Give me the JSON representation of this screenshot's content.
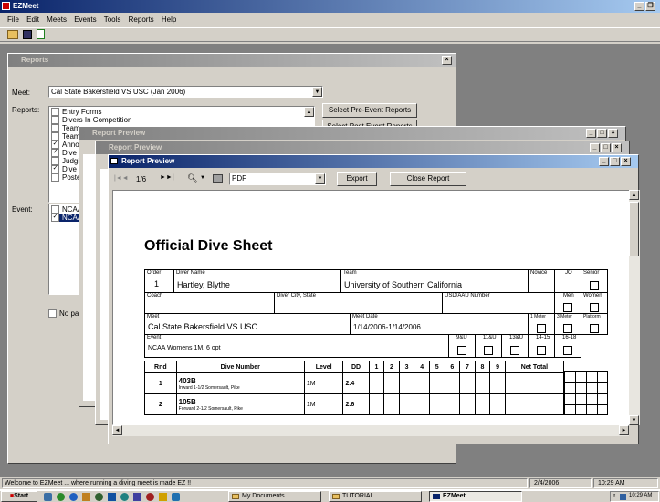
{
  "app": {
    "title": "EZMeet",
    "menu": [
      "File",
      "Edit",
      "Meets",
      "Events",
      "Tools",
      "Reports",
      "Help"
    ]
  },
  "reports_window": {
    "title": "Reports",
    "meet_label": "Meet:",
    "meet_value": "Cal State Bakersfield VS USC (Jan 2006)",
    "reports_label": "Reports:",
    "report_items": [
      {
        "label": "Entry Forms",
        "checked": false
      },
      {
        "label": "Divers In Competition",
        "checked": false
      },
      {
        "label": "Teams",
        "checked": false
      },
      {
        "label": "Teams",
        "checked": false
      },
      {
        "label": "Annou",
        "checked": true
      },
      {
        "label": "Dive O",
        "checked": true
      },
      {
        "label": "Judgin",
        "checked": false
      },
      {
        "label": "Dive S",
        "checked": true
      },
      {
        "label": "Posted",
        "checked": false
      }
    ],
    "select_pre_btn": "Select Pre-Event Reports",
    "select_post_btn": "Select Post Event Reports",
    "event_label": "Event:",
    "event_items": [
      {
        "label": "NCAA",
        "checked": false
      },
      {
        "label": "NCAA",
        "checked": true
      }
    ],
    "no_page_label": "No pag"
  },
  "preview_windows": {
    "back_title": "Report Preview",
    "mid_title": "Report Preview",
    "front_title": "Report Preview"
  },
  "preview_toolbar": {
    "page": "1/6",
    "format": "PDF",
    "export_btn": "Export",
    "close_btn": "Close Report"
  },
  "dive_sheet": {
    "title": "Official Dive Sheet",
    "order_label": "Order",
    "order_value": "1",
    "diver_name_label": "Diver Name",
    "diver_name_value": "Hartley, Blythe",
    "team_label": "Team",
    "team_value": "University of Southern California",
    "novice_label": "Novice",
    "jo_label": "JO",
    "senior_label": "Senior",
    "coach_label": "Coach",
    "diver_city_label": "Diver City, State",
    "usd_label": "USD/AAU Number",
    "men_label": "Men",
    "women_label": "Women",
    "meet_label": "Meet",
    "meet_value": "Cal State Bakersfield VS USC",
    "meet_date_label": "Meet Date",
    "meet_date_value": "1/14/2006-1/14/2006",
    "meter1_label": "1 Meter",
    "meter3_label": "3 Meter",
    "platform_label": "Platform",
    "event_label": "Event",
    "event_value": "NCAA Womens 1M, 6 opt",
    "age_labels": [
      "9&U",
      "11&U",
      "13&U",
      "14-15",
      "16-18"
    ],
    "table_headers": [
      "Rnd",
      "Dive Number",
      "Level",
      "DD",
      "1",
      "2",
      "3",
      "4",
      "5",
      "6",
      "7",
      "8",
      "9",
      "Net Total"
    ],
    "dives": [
      {
        "rnd": "1",
        "number": "403B",
        "desc": "Inward 1-1/2 Somersault, Pike",
        "level": "1M",
        "dd": "2.4"
      },
      {
        "rnd": "2",
        "number": "105B",
        "desc": "Forward 2-1/2 Somersault, Pike",
        "level": "1M",
        "dd": "2.6"
      }
    ]
  },
  "status_bar": {
    "message": "Welcome to EZMeet ... where running a diving meet is made EZ !!",
    "date": "2/4/2006",
    "time": "10:29 AM"
  },
  "taskbar": {
    "start": "Start",
    "tasks": [
      "My Documents",
      "TUTORIAL",
      "EZMeet"
    ],
    "clock": "10:29 AM"
  }
}
